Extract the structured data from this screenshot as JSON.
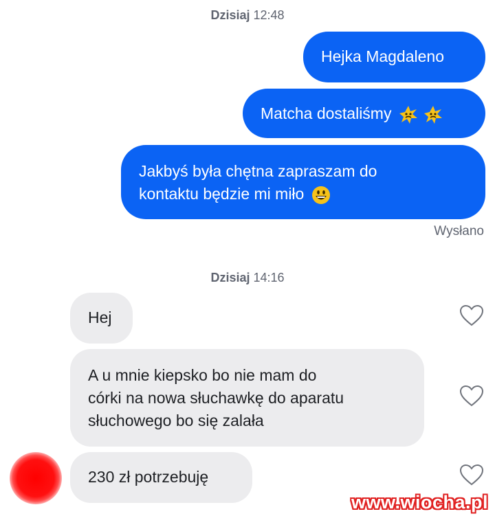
{
  "timestamps": {
    "first": {
      "day": "Dzisiaj",
      "time": "12:48"
    },
    "second": {
      "day": "Dzisiaj",
      "time": "14:16"
    }
  },
  "outgoing": [
    {
      "text": "Hejka Magdaleno"
    },
    {
      "text": "Matcha dostaliśmy",
      "emoji": "sparkle-face-emoji x2"
    },
    {
      "text_line1": "Jakbyś była chętna zapraszam do",
      "text_line2": "kontaktu będzie mi miło",
      "emoji": "grinning-face-emoji"
    }
  ],
  "status": "Wysłano",
  "incoming": [
    {
      "text": "Hej"
    },
    {
      "line1": "A u mnie kiepsko bo nie mam do",
      "line2": "córki na nowa słuchawkę do aparatu",
      "line3": "słuchowego bo się zalała"
    },
    {
      "text": "230 zł potrzebuję"
    }
  ],
  "icons": {
    "like": "heart-outline-icon"
  },
  "colors": {
    "outgoing": "#0b63f4",
    "incoming": "#ececee",
    "avatar": "#ff0000"
  },
  "watermark": "www.wiocha.pl"
}
